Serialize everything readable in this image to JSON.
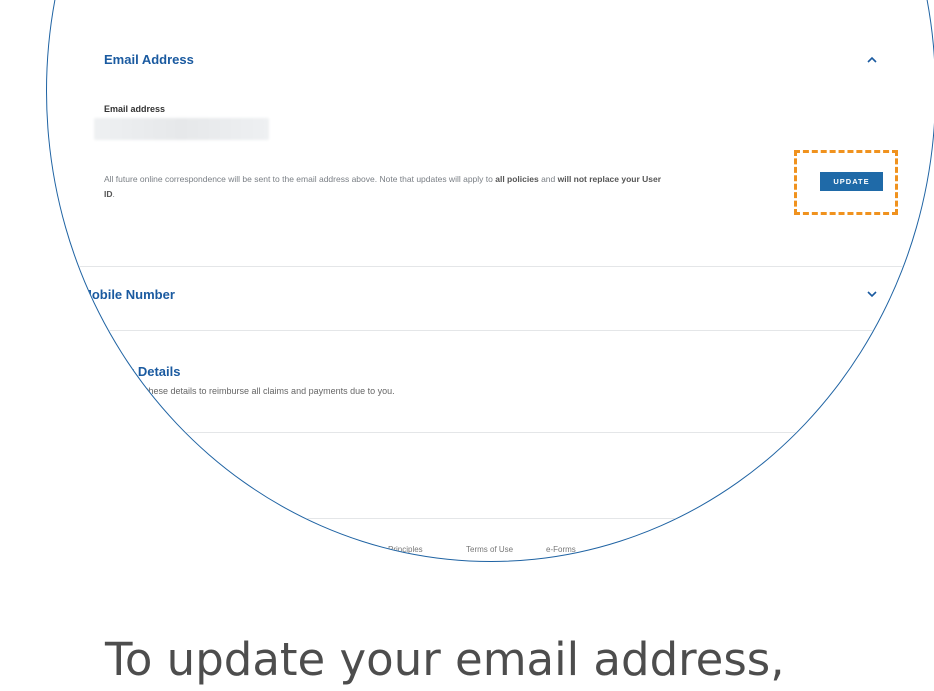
{
  "email_section": {
    "title": "Email Address",
    "field_label": "Email address",
    "field_value": "",
    "info_part1": "All future online correspondence will be sent to the email address above. Note that updates will apply to ",
    "info_bold1": "all policies",
    "info_part2": " and ",
    "info_bold2": "will not replace your User ID",
    "info_part3": ".",
    "update_label": "UPDATE"
  },
  "mobile_section": {
    "title": "Mobile Number"
  },
  "bank_section": {
    "title": "k Details",
    "description": "these details to reimburse all claims and payments due to you."
  },
  "footer": {
    "links": [
      "Principles",
      "Terms of Use",
      "e-Forms"
    ]
  },
  "caption": "To update your email address,",
  "colors": {
    "accent": "#1a5aa0",
    "button": "#1f6aa8",
    "highlight": "#f0921e"
  },
  "icons": {
    "email_toggle": "chevron-up-icon",
    "mobile_toggle": "chevron-down-icon"
  }
}
